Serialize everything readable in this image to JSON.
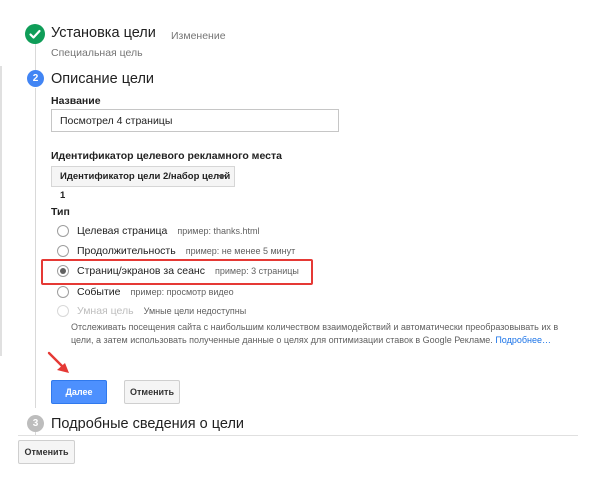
{
  "steps": {
    "step1": {
      "title": "Установка цели",
      "edit_label": "Изменение",
      "subtitle": "Специальная цель"
    },
    "step2": {
      "number": "2",
      "title": "Описание цели"
    },
    "step3": {
      "number": "3",
      "title": "Подробные сведения о цели"
    }
  },
  "form": {
    "name_label": "Название",
    "name_value": "Посмотрел 4 страницы",
    "slot_label": "Идентификатор целевого рекламного места",
    "slot_value": "Идентификатор цели 2/набор целей 1",
    "type_label": "Тип",
    "types": [
      {
        "label": "Целевая страница",
        "example": "пример: thanks.html"
      },
      {
        "label": "Продолжительность",
        "example": "пример: не менее 5 минут"
      },
      {
        "label": "Страниц/экранов за сеанс",
        "example": "пример: 3 страницы",
        "selected": true
      },
      {
        "label": "Событие",
        "example": "пример: просмотр видео"
      },
      {
        "label": "Умная цель",
        "example": "Умные цели недоступны",
        "disabled": true
      }
    ],
    "smart_description": "Отслеживать посещения сайта с наибольшим количеством взаимодействий и автоматически преобразовывать их в цели, а затем использовать полученные данные о целях для оптимизации ставок в Google Рекламе.",
    "more_link": "Подробнее…"
  },
  "buttons": {
    "next": "Далее",
    "cancel_inner": "Отменить",
    "cancel_outer": "Отменить"
  },
  "colors": {
    "done_step": "#0f9d58",
    "active_step": "#4285f4",
    "primary_button": "#4d90fe",
    "highlight": "#e53935"
  },
  "icons": {
    "step1": "checkmark-icon",
    "dropdown": "caret-down-icon",
    "annotation": "red-arrow-icon"
  }
}
